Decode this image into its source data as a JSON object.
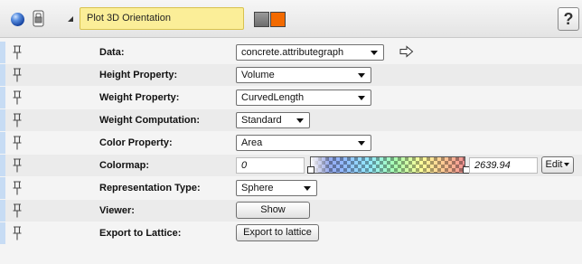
{
  "window": {
    "title": "Plot 3D Orientation",
    "swatch_colors": [
      "#808080",
      "#f36a00"
    ],
    "help_label": "?"
  },
  "properties": [
    {
      "label": "Data:",
      "control": "dropdown",
      "value": "concrete.attributegraph"
    },
    {
      "label": "Height Property:",
      "control": "dropdown",
      "value": "Volume"
    },
    {
      "label": "Weight Property:",
      "control": "dropdown",
      "value": "CurvedLength"
    },
    {
      "label": "Weight Computation:",
      "control": "dropdown",
      "value": "Standard"
    },
    {
      "label": "Color Property:",
      "control": "dropdown",
      "value": "Area"
    },
    {
      "label": "Colormap:",
      "control": "colormap",
      "min": "0",
      "max": "2639.94",
      "edit_label": "Edit"
    },
    {
      "label": "Representation Type:",
      "control": "dropdown",
      "value": "Sphere"
    },
    {
      "label": "Viewer:",
      "control": "button",
      "value": "Show"
    },
    {
      "label": "Export to Lattice:",
      "control": "button",
      "value": "Export to lattice"
    }
  ],
  "icons": {
    "visibility": "sphere-icon",
    "lock": "lock-icon",
    "collapse": "collapse-triangle-icon",
    "pin": "pin-icon",
    "goto": "arrow-right-icon"
  }
}
